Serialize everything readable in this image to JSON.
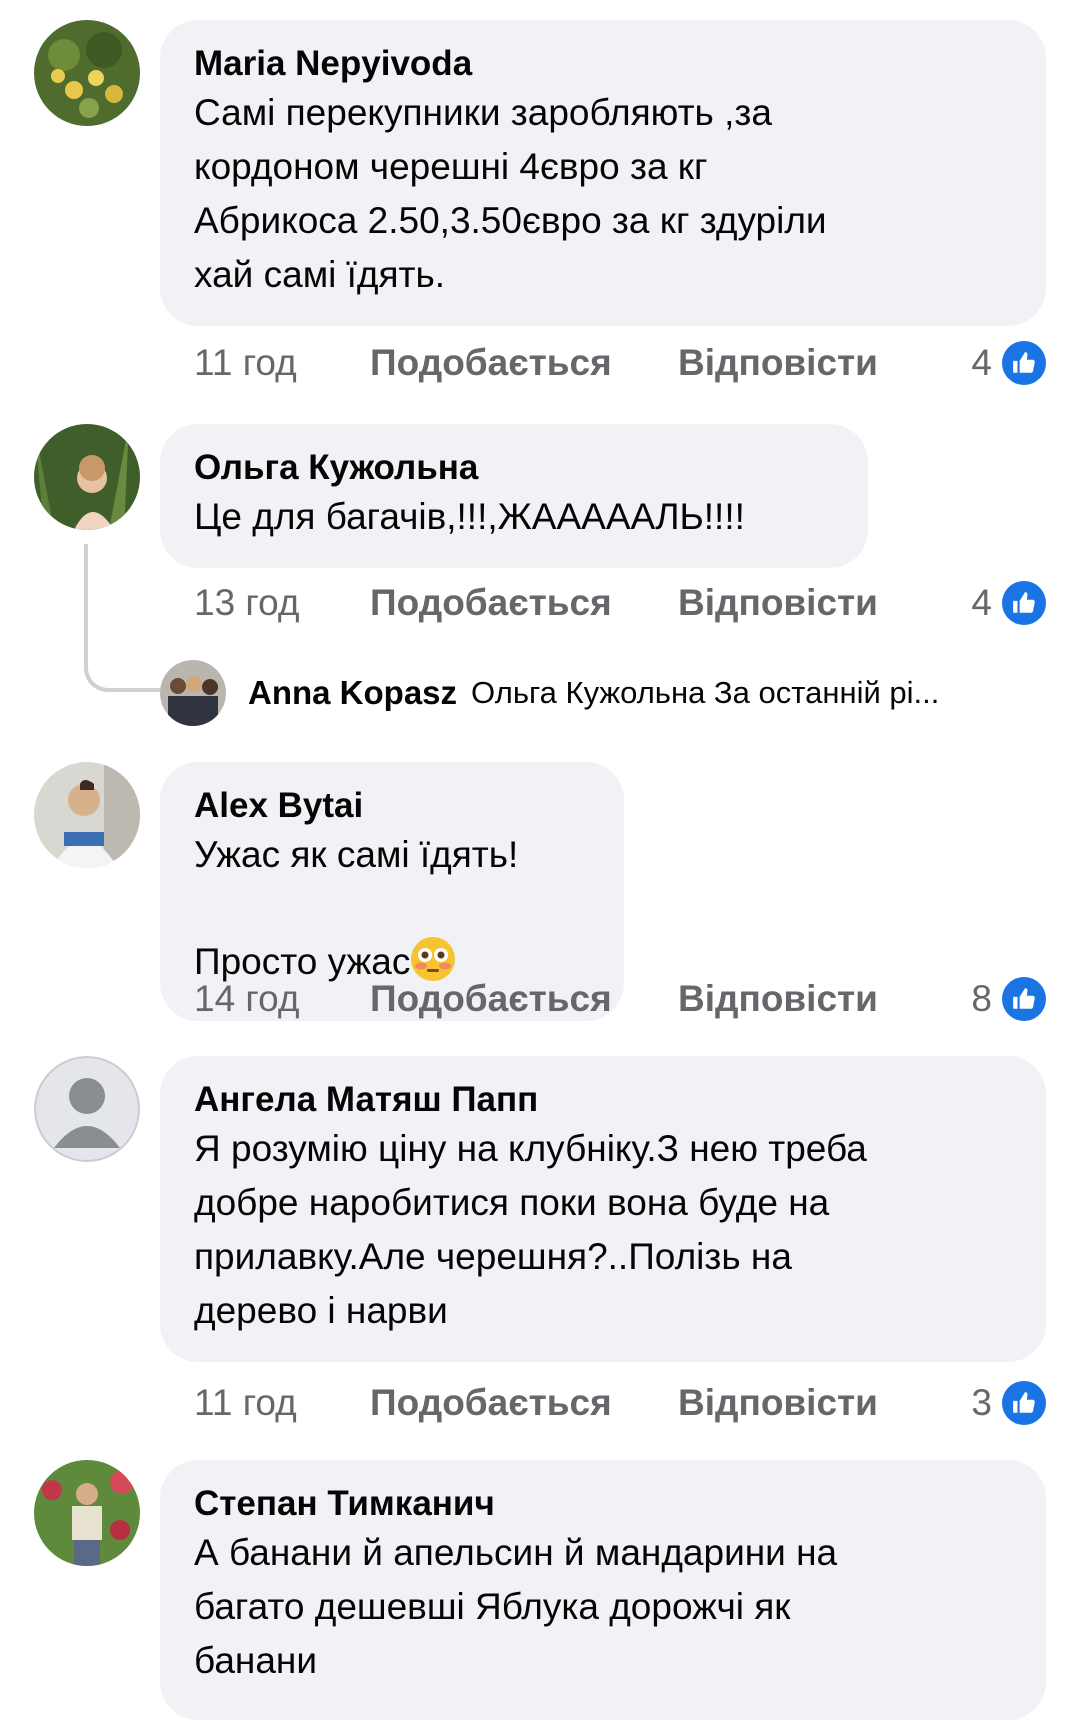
{
  "comments": [
    {
      "author": "Maria Nepyivoda",
      "text": "Самі перекупники заробляють ,за\nкордоном черешні 4євро за кг\nАбрикоса 2.50,3.50євро за кг здуріли\nхай самі їдять.",
      "time": "11 год",
      "like_label": "Подобається",
      "reply_label": "Відповісти",
      "reactions": "4"
    },
    {
      "author": "Ольга Кужольна",
      "text": "Це для багачів,!!!,ЖААААAЛЬ!!!!",
      "time": "13 год",
      "like_label": "Подобається",
      "reply_label": "Відповісти",
      "reactions": "4"
    },
    {
      "author": "Alex Bytai",
      "text": "Ужас як самі їдять!\nПросто ужас",
      "time": "14 год",
      "like_label": "Подобається",
      "reply_label": "Відповісти",
      "reactions": "8"
    },
    {
      "author": "Ангела Матяш Папп",
      "text": "Я розумію ціну на клубніку.З нею треба\nдобре наробитися поки вона буде на\nприлавку.Але черешня?..Полізь на\nдерево і нарви",
      "time": "11 год",
      "like_label": "Подобається",
      "reply_label": "Відповісти",
      "reactions": "3"
    },
    {
      "author": "Степан Тимканич",
      "text": "А банани й апельсин й мандарини на\nбагато дешевші Яблука дорожчі як\nбанани"
    }
  ],
  "reply_preview": {
    "author": "Anna Kopasz",
    "text": "Ольга Кужольна За останній рі..."
  },
  "emoji": "flushed-face-emoji",
  "icons": [
    "like-icon",
    "default-avatar-icon"
  ],
  "colors": {
    "bubble": "#f0f2f5",
    "meta": "#65676b",
    "like_blue": "#1b74e4",
    "text": "#050505"
  }
}
